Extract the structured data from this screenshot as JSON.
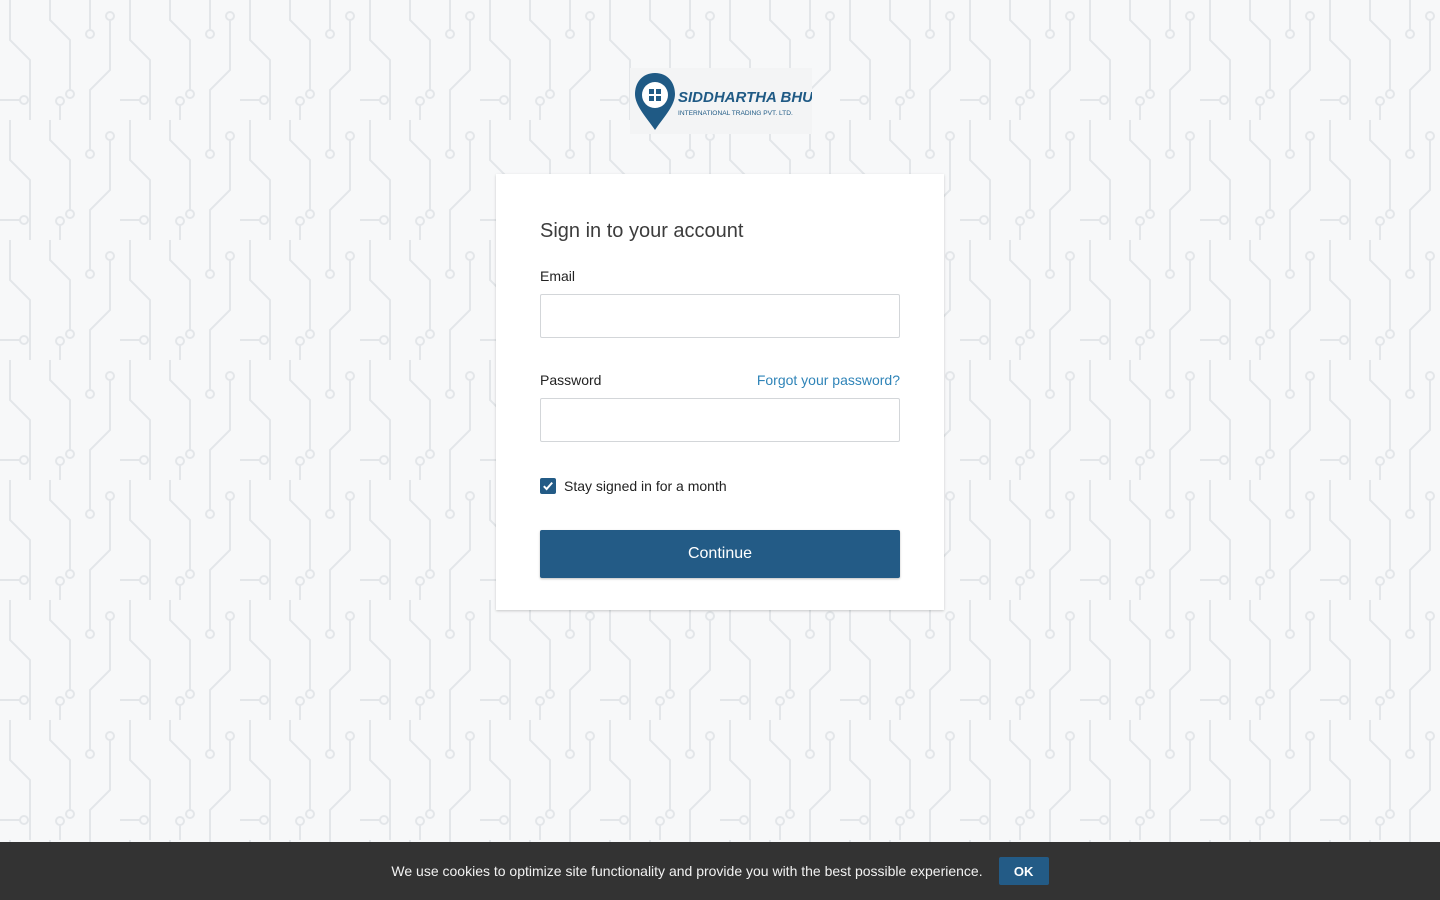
{
  "brand": {
    "name": "SIDDHARTHA BHUMI",
    "tagline": "INTERNATIONAL TRADING PVT. LTD.",
    "color": "#1f5a85"
  },
  "signin": {
    "title": "Sign in to your account",
    "email_label": "Email",
    "email_value": "",
    "password_label": "Password",
    "password_value": "",
    "forgot_link": "Forgot your password?",
    "stay_signed_in_label": "Stay signed in for a month",
    "stay_signed_in_checked": true,
    "continue_button": "Continue"
  },
  "cookie_banner": {
    "text": "We use cookies to optimize site functionality and provide you with the best possible experience.",
    "ok_button": "OK"
  },
  "colors": {
    "primary": "#235b86",
    "link": "#2f84b8",
    "cookie_bg": "#333333"
  }
}
